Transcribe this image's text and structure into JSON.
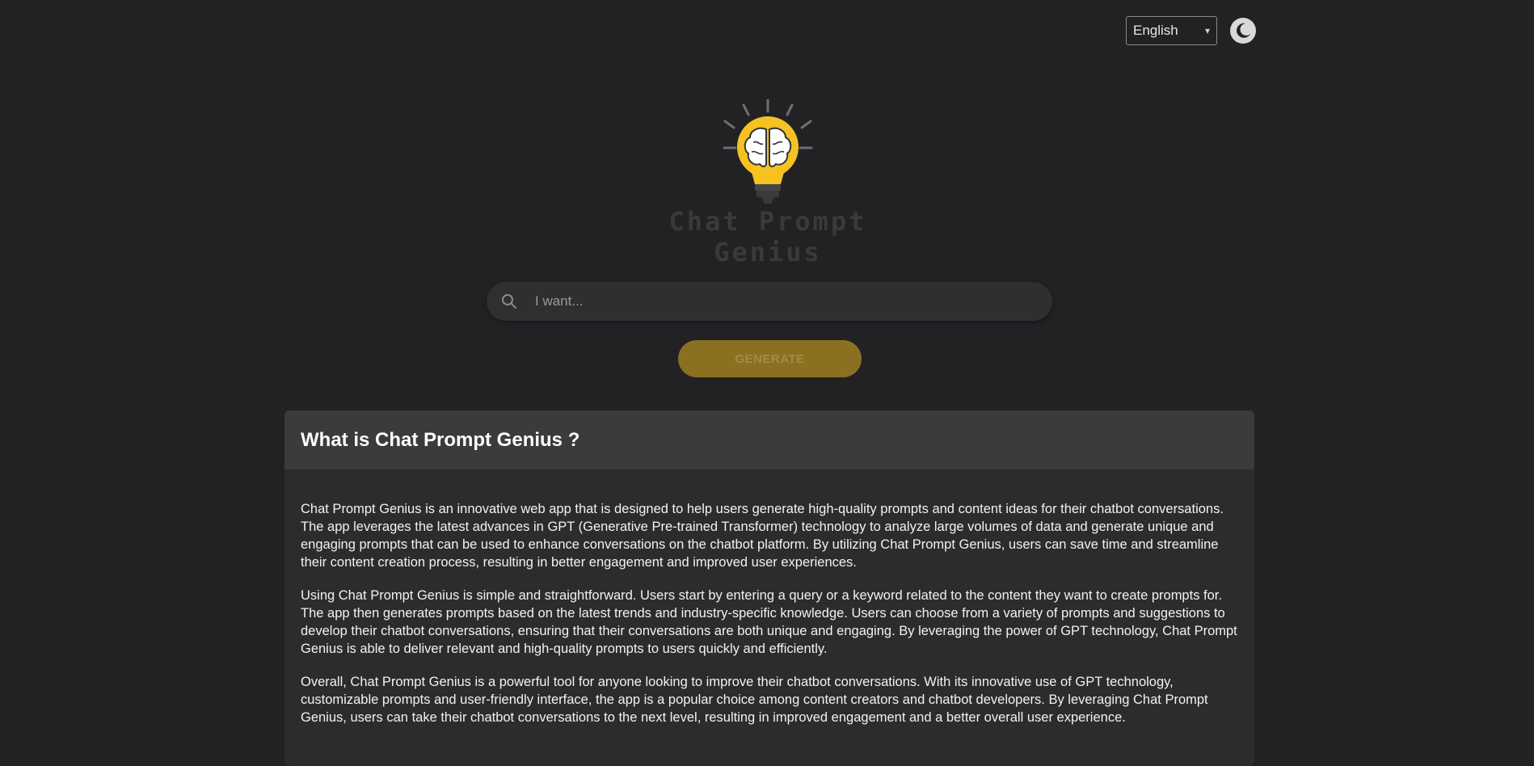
{
  "header": {
    "language": {
      "selected": "English"
    },
    "theme_toggle": {
      "icon": "moon-icon"
    }
  },
  "logo": {
    "icon": "lightbulb-brain-icon",
    "text_line1": "Chat Prompt",
    "text_line2": "Genius",
    "colors": {
      "bulb": "#f5c221",
      "text": "#3a3a3c"
    }
  },
  "search": {
    "placeholder": "I want...",
    "value": "",
    "icon": "search-icon"
  },
  "generate_button": {
    "label": "GENERATE",
    "color": "#8a7020"
  },
  "about": {
    "title": "What is Chat Prompt Genius ?",
    "paragraphs": [
      "Chat Prompt Genius is an innovative web app that is designed to help users generate high-quality prompts and content ideas for their chatbot conversations. The app leverages the latest advances in GPT (Generative Pre-trained Transformer) technology to analyze large volumes of data and generate unique and engaging prompts that can be used to enhance conversations on the chatbot platform. By utilizing Chat Prompt Genius, users can save time and streamline their content creation process, resulting in better engagement and improved user experiences.",
      "Using Chat Prompt Genius is simple and straightforward. Users start by entering a query or a keyword related to the content they want to create prompts for. The app then generates prompts based on the latest trends and industry-specific knowledge. Users can choose from a variety of prompts and suggestions to develop their chatbot conversations, ensuring that their conversations are both unique and engaging. By leveraging the power of GPT technology, Chat Prompt Genius is able to deliver relevant and high-quality prompts to users quickly and efficiently.",
      "Overall, Chat Prompt Genius is a powerful tool for anyone looking to improve their chatbot conversations. With its innovative use of GPT technology, customizable prompts and user-friendly interface, the app is a popular choice among content creators and chatbot developers. By leveraging Chat Prompt Genius, users can take their chatbot conversations to the next level, resulting in improved engagement and a better overall user experience."
    ]
  },
  "colors": {
    "background": "#222225",
    "card": "#2c2c2f",
    "card_header": "#3b3b3d"
  }
}
